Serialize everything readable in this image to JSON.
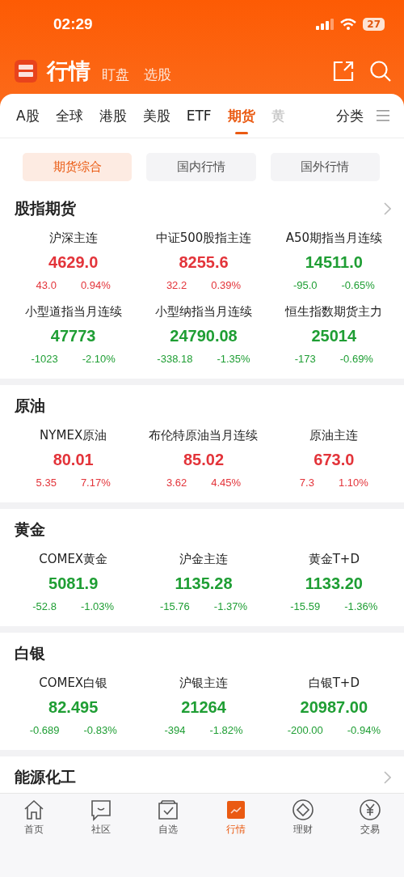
{
  "status_bar": {
    "time": "02:29",
    "battery": "27"
  },
  "header": {
    "title": "行情",
    "links": [
      "盯盘",
      "选股"
    ]
  },
  "tabs": [
    {
      "label": "A股",
      "selected": false
    },
    {
      "label": "全球",
      "selected": false
    },
    {
      "label": "港股",
      "selected": false
    },
    {
      "label": "美股",
      "selected": false
    },
    {
      "label": "ETF",
      "selected": false
    },
    {
      "label": "期货",
      "selected": true
    },
    {
      "label": "黄",
      "selected": false,
      "faded": true
    }
  ],
  "category_tab": "分类",
  "sub_tabs": [
    {
      "label": "期货综合",
      "selected": true
    },
    {
      "label": "国内行情",
      "selected": false
    },
    {
      "label": "国外行情",
      "selected": false
    }
  ],
  "sections": [
    {
      "title": "股指期货",
      "more": true,
      "quotes": [
        {
          "name": "沪深主连",
          "price": "4629.0",
          "change": "43.0",
          "percent": "0.94%",
          "kind": "up"
        },
        {
          "name": "中证500股指主连",
          "price": "8255.6",
          "change": "32.2",
          "percent": "0.39%",
          "kind": "up"
        },
        {
          "name": "A50期指当月连续",
          "price": "14511.0",
          "change": "-95.0",
          "percent": "-0.65%",
          "kind": "down"
        },
        {
          "name": "小型道指当月连续",
          "price": "47773",
          "change": "-1023",
          "percent": "-2.10%",
          "kind": "down"
        },
        {
          "name": "小型纳指当月连续",
          "price": "24790.08",
          "change": "-338.18",
          "percent": "-1.35%",
          "kind": "down"
        },
        {
          "name": "恒生指数期货主力",
          "price": "25014",
          "change": "-173",
          "percent": "-0.69%",
          "kind": "down"
        }
      ]
    },
    {
      "title": "原油",
      "more": false,
      "quotes": [
        {
          "name": "NYMEX原油",
          "price": "80.01",
          "change": "5.35",
          "percent": "7.17%",
          "kind": "up"
        },
        {
          "name": "布伦特原油当月连续",
          "price": "85.02",
          "change": "3.62",
          "percent": "4.45%",
          "kind": "up"
        },
        {
          "name": "原油主连",
          "price": "673.0",
          "change": "7.3",
          "percent": "1.10%",
          "kind": "up"
        }
      ]
    },
    {
      "title": "黄金",
      "more": false,
      "quotes": [
        {
          "name": "COMEX黄金",
          "price": "5081.9",
          "change": "-52.8",
          "percent": "-1.03%",
          "kind": "down"
        },
        {
          "name": "沪金主连",
          "price": "1135.28",
          "change": "-15.76",
          "percent": "-1.37%",
          "kind": "down"
        },
        {
          "name": "黄金T+D",
          "price": "1133.20",
          "change": "-15.59",
          "percent": "-1.36%",
          "kind": "down"
        }
      ]
    },
    {
      "title": "白银",
      "more": false,
      "quotes": [
        {
          "name": "COMEX白银",
          "price": "82.495",
          "change": "-0.689",
          "percent": "-0.83%",
          "kind": "down"
        },
        {
          "name": "沪银主连",
          "price": "21264",
          "change": "-394",
          "percent": "-1.82%",
          "kind": "down"
        },
        {
          "name": "白银T+D",
          "price": "20987.00",
          "change": "-200.00",
          "percent": "-0.94%",
          "kind": "down"
        }
      ]
    },
    {
      "title": "能源化工",
      "more": true
    }
  ],
  "bottom_nav": [
    {
      "label": "首页",
      "selected": false
    },
    {
      "label": "社区",
      "selected": false
    },
    {
      "label": "自选",
      "selected": false
    },
    {
      "label": "行情",
      "selected": true
    },
    {
      "label": "理财",
      "selected": false
    },
    {
      "label": "交易",
      "selected": false
    }
  ]
}
